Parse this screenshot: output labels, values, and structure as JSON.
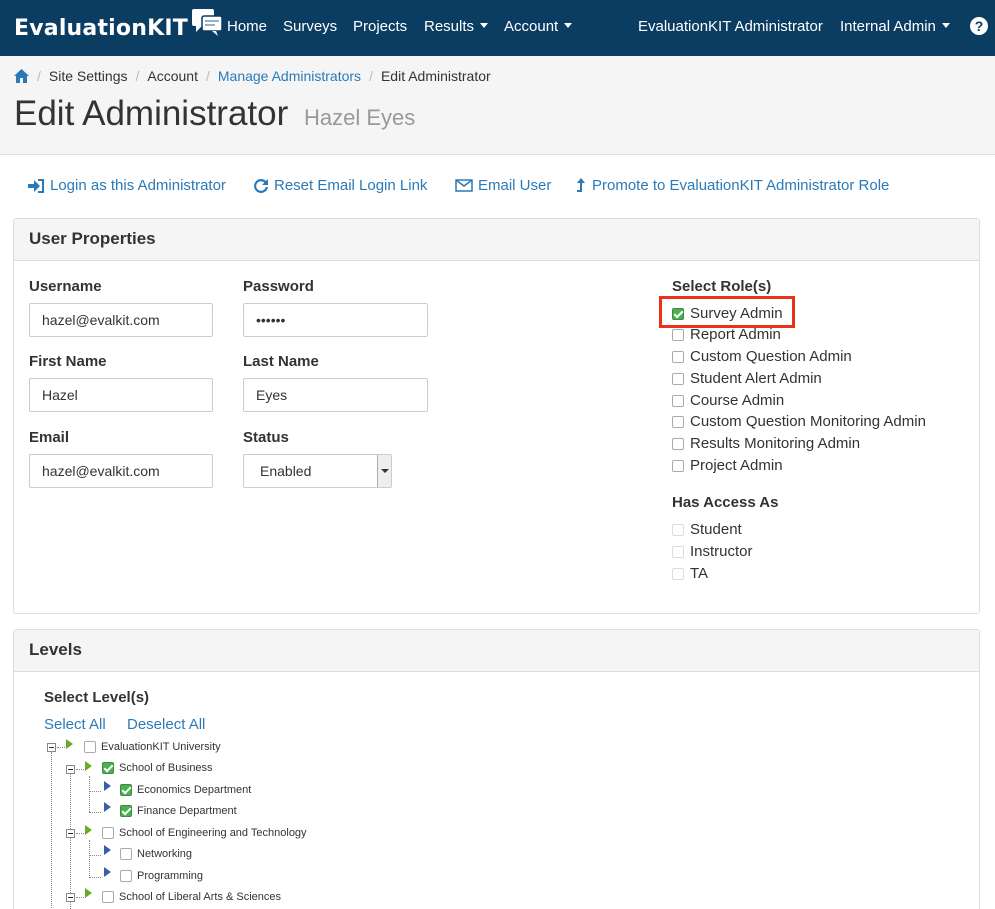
{
  "nav": {
    "brand": "EvaluationKIT",
    "home": "Home",
    "surveys": "Surveys",
    "projects": "Projects",
    "results": "Results",
    "account": "Account",
    "user_name": "EvaluationKIT Administrator",
    "role_menu": "Internal Admin",
    "help": "?"
  },
  "breadcrumb": {
    "site_settings": "Site Settings",
    "account": "Account",
    "manage_admins": "Manage Administrators",
    "current": "Edit Administrator"
  },
  "page": {
    "title": "Edit Administrator",
    "subtitle": "Hazel Eyes"
  },
  "actions": {
    "login_as": "Login as this Administrator",
    "reset_email": "Reset Email Login Link",
    "email_user": "Email User",
    "promote": "Promote to EvaluationKIT Administrator Role"
  },
  "user_properties": {
    "heading": "User Properties",
    "username_label": "Username",
    "username_value": "hazel@evalkit.com",
    "password_label": "Password",
    "password_value": "••••••",
    "first_name_label": "First Name",
    "first_name_value": "Hazel",
    "last_name_label": "Last Name",
    "last_name_value": "Eyes",
    "email_label": "Email",
    "email_value": "hazel@evalkit.com",
    "status_label": "Status",
    "status_value": "Enabled",
    "roles_label": "Select Role(s)",
    "roles": [
      {
        "label": "Survey Admin",
        "checked": true
      },
      {
        "label": "Report Admin",
        "checked": false
      },
      {
        "label": "Custom Question Admin",
        "checked": false
      },
      {
        "label": "Student Alert Admin",
        "checked": false
      },
      {
        "label": "Course Admin",
        "checked": false
      },
      {
        "label": "Custom Question Monitoring Admin",
        "checked": false
      },
      {
        "label": "Results Monitoring Admin",
        "checked": false
      },
      {
        "label": "Project Admin",
        "checked": false
      }
    ],
    "access_label": "Has Access As",
    "access": [
      {
        "label": "Student",
        "checked": false
      },
      {
        "label": "Instructor",
        "checked": false
      },
      {
        "label": "TA",
        "checked": false
      }
    ]
  },
  "levels": {
    "heading": "Levels",
    "select_label": "Select Level(s)",
    "select_all": "Select All",
    "deselect_all": "Deselect All",
    "tree": [
      {
        "label": "EvaluationKIT University",
        "checked": false
      },
      {
        "label": "School of Business",
        "checked": true
      },
      {
        "label": "Economics Department",
        "checked": true
      },
      {
        "label": "Finance Department",
        "checked": true
      },
      {
        "label": "School of Engineering and Technology",
        "checked": false
      },
      {
        "label": "Networking",
        "checked": false
      },
      {
        "label": "Programming",
        "checked": false
      },
      {
        "label": "School of Liberal Arts & Sciences",
        "checked": false
      }
    ]
  },
  "colors": {
    "navbar": "#0b3d62",
    "link": "#2a7ab8",
    "highlight": "#e8321b",
    "check": "#4caf50"
  }
}
